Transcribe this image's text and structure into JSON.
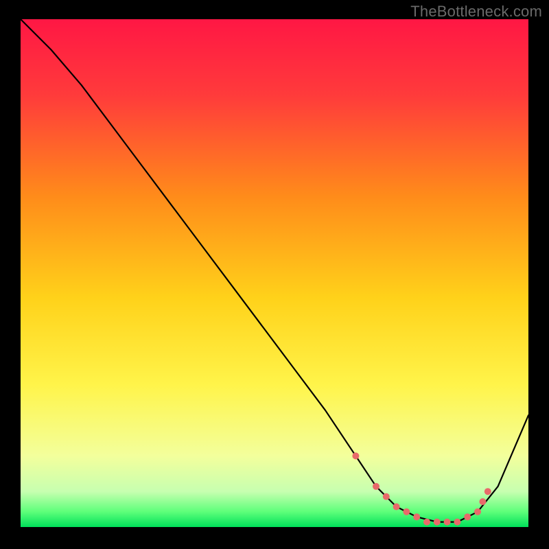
{
  "watermark": "TheBottleneck.com",
  "chart_data": {
    "type": "line",
    "title": "",
    "xlabel": "",
    "ylabel": "",
    "xlim": [
      0,
      100
    ],
    "ylim": [
      0,
      100
    ],
    "gradient_stops": [
      {
        "offset": 0,
        "color": "#ff1744"
      },
      {
        "offset": 15,
        "color": "#ff3b3b"
      },
      {
        "offset": 35,
        "color": "#ff8c1a"
      },
      {
        "offset": 55,
        "color": "#ffd21a"
      },
      {
        "offset": 72,
        "color": "#fff44a"
      },
      {
        "offset": 86,
        "color": "#f3ff9c"
      },
      {
        "offset": 93,
        "color": "#c7ffb0"
      },
      {
        "offset": 97,
        "color": "#5dff7a"
      },
      {
        "offset": 100,
        "color": "#00e05a"
      }
    ],
    "series": [
      {
        "name": "bottleneck-curve",
        "color": "#000000",
        "x": [
          0,
          6,
          12,
          18,
          24,
          30,
          36,
          42,
          48,
          54,
          60,
          66,
          70,
          74,
          78,
          82,
          86,
          90,
          94,
          100
        ],
        "y": [
          100,
          94,
          87,
          79,
          71,
          63,
          55,
          47,
          39,
          31,
          23,
          14,
          8,
          4,
          2,
          1,
          1,
          3,
          8,
          22
        ]
      }
    ],
    "markers": {
      "name": "highlight-points",
      "color": "#e86a6a",
      "radius": 5,
      "x": [
        66,
        70,
        72,
        74,
        76,
        78,
        80,
        82,
        84,
        86,
        88,
        90,
        91,
        92
      ],
      "y": [
        14,
        8,
        6,
        4,
        3,
        2,
        1,
        1,
        1,
        1,
        2,
        3,
        5,
        7
      ]
    }
  }
}
